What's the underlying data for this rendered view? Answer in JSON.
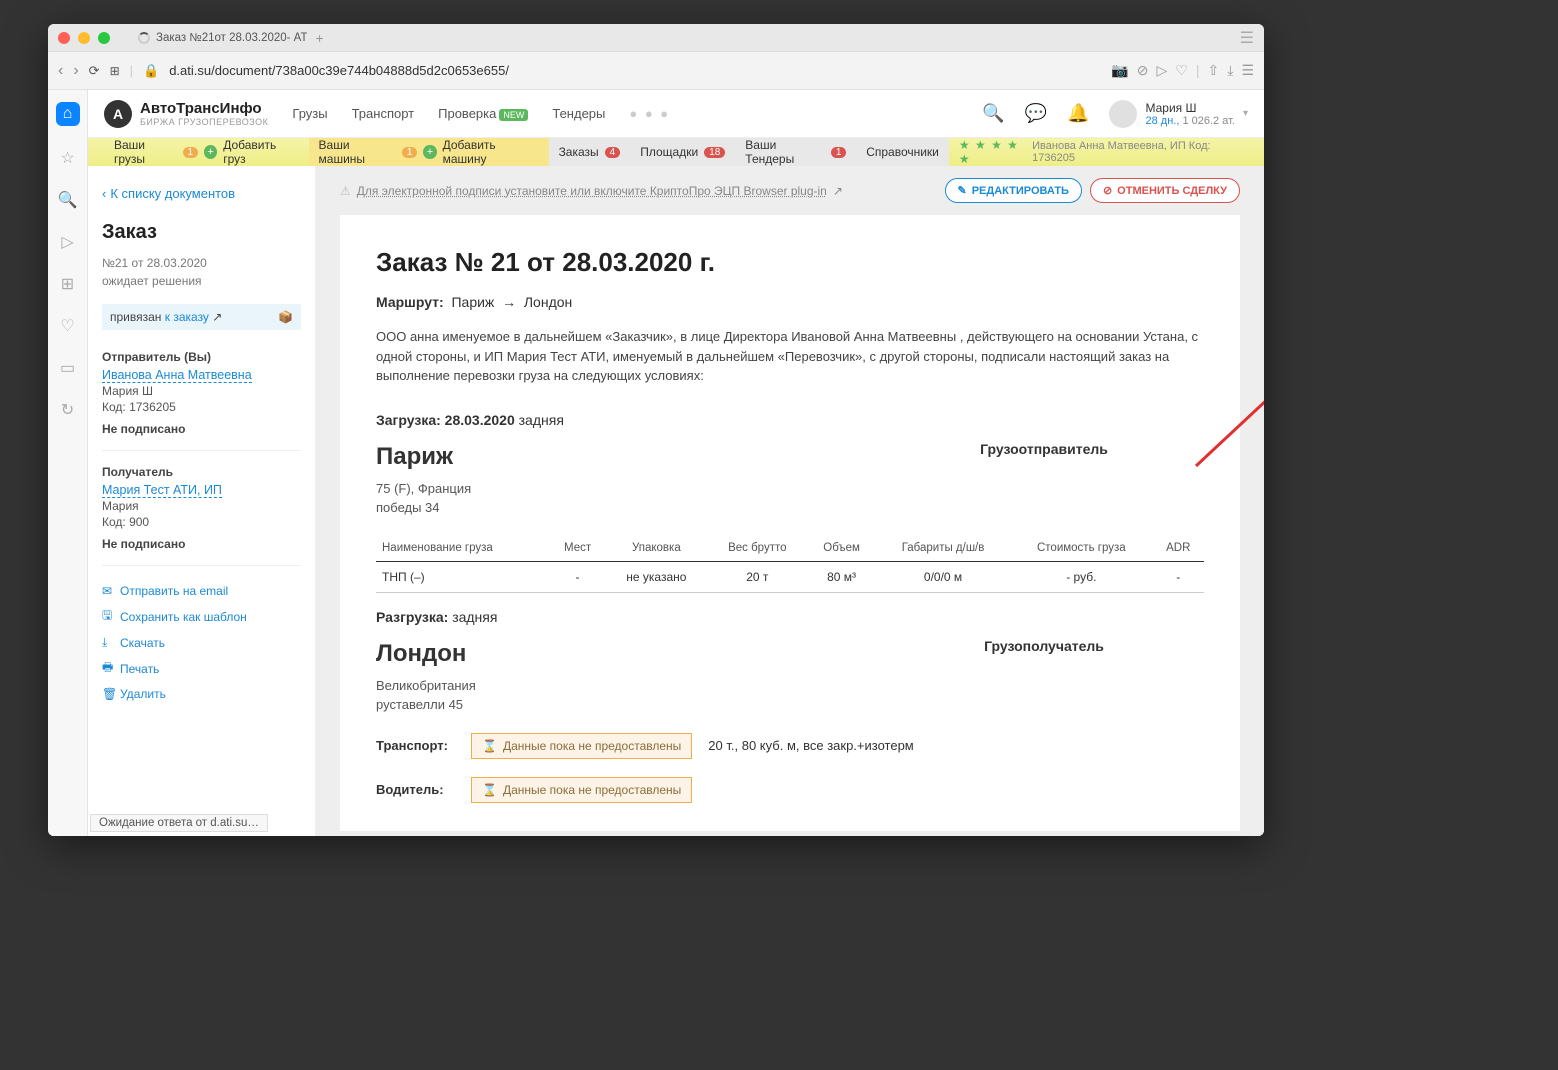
{
  "browser": {
    "tab_title": "Заказ №21от 28.03.2020- АТ",
    "url": "d.ati.su/document/738a00c39e744b04888d5d2c0653e655/"
  },
  "topnav": {
    "brand_line1": "АвтоТрансИнфо",
    "brand_line2": "БИРЖА ГРУЗОПЕРЕВОЗОК",
    "menu": {
      "m1": "Грузы",
      "m2": "Транспорт",
      "m3": "Проверка",
      "m3_badge": "NEW",
      "m4": "Тендеры"
    },
    "user": {
      "name": "Мария Ш",
      "sub_days": "28 дн.,",
      "sub_bal": "1 026.2 ат."
    }
  },
  "subnav": {
    "s1": "Ваши грузы",
    "s1c": "1",
    "s1a": "Добавить груз",
    "s2": "Ваши машины",
    "s2c": "1",
    "s2a": "Добавить машину",
    "s3": "Заказы",
    "s3c": "4",
    "s4": "Площадки",
    "s4c": "18",
    "s5": "Ваши Тендеры",
    "s5c": "1",
    "s6": "Справочники",
    "company": "Иванова Анна Матвеевна, ИП  Код: 1736205"
  },
  "left": {
    "back": "К списку документов",
    "title": "Заказ",
    "num": "№21 от 28.03.2020",
    "status": "ожидает решения",
    "linked_pre": "привязан ",
    "linked_link": "к заказу",
    "sender_label": "Отправитель (Вы)",
    "sender_name": "Иванова Анна Матвеевна",
    "sender_person": "Мария Ш",
    "sender_code": "Код: 1736205",
    "sender_sign": "Не подписано",
    "recv_label": "Получатель",
    "recv_name": "Мария Тест АТИ, ИП",
    "recv_person": "Мария",
    "recv_code": "Код: 900",
    "recv_sign": "Не подписано",
    "act": {
      "email": "Отправить на email",
      "tpl": "Сохранить как шаблон",
      "dl": "Скачать",
      "print": "Печать",
      "del": "Удалить"
    }
  },
  "docbar": {
    "warn": "Для электронной подписи установите или включите КриптоПро ЭЦП Browser plug-in",
    "edit": "РЕДАКТИРОВАТЬ",
    "cancel": "ОТМЕНИТЬ СДЕЛКУ"
  },
  "paper": {
    "title": "Заказ №  21 от 28.03.2020 г.",
    "route_lbl": "Маршрут:",
    "route_from": "Париж",
    "route_to": "Лондон",
    "intro": "ООО анна именуемое в дальнейшем «Заказчик», в лице Директора Ивановой Анна Матвеевны , действующего на основании Устана, с одной стороны, и ИП Мария Тест АТИ, именуемый в дальнейшем «Перевозчик», с другой стороны, подписали настоящий заказ на выполнение перевозки груза на следующих условиях:",
    "load_lbl": "Загрузка:",
    "load_date": "28.03.2020",
    "load_type": "задняя",
    "shipper_lbl": "Грузоотправитель",
    "load_city": "Париж",
    "load_country": "75 (F), Франция",
    "load_addr": "победы 34",
    "tbl": {
      "h": [
        "Наименование груза",
        "Мест",
        "Упаковка",
        "Вес брутто",
        "Объем",
        "Габариты д/ш/в",
        "Стоимость груза",
        "ADR"
      ],
      "row": [
        "ТНП (–)",
        "-",
        "не указано",
        "20 т",
        "80 м³",
        "0/0/0 м",
        "- руб.",
        "-"
      ]
    },
    "unload_lbl": "Разгрузка:",
    "unload_type": "задняя",
    "consignee_lbl": "Грузополучатель",
    "unload_city": "Лондон",
    "unload_country": "Великобритания",
    "unload_addr": "руставелли 45",
    "transport_lbl": "Транспорт:",
    "badge_txt": "Данные пока не предоставлены",
    "transport_val": "20 т., 80 куб. м, все закр.+изотерм",
    "driver_lbl": "Водитель:"
  },
  "status_bar": "Ожидание ответа от d.ati.su…"
}
